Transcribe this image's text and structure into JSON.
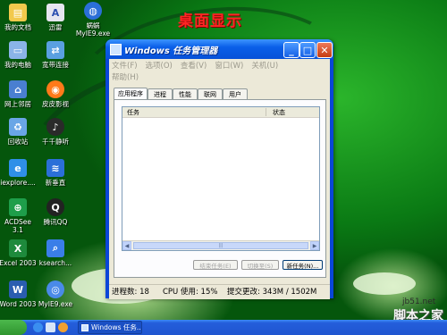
{
  "desktop": {
    "title": "桌面显示",
    "icons": [
      {
        "label": "我的文档",
        "icon": "folder-icon",
        "color": "#f2c94c"
      },
      {
        "label": "迅雷",
        "icon": "thunder-icon",
        "color": "#e6e6f0"
      },
      {
        "label": "蜗蜗",
        "icon": "app-icon",
        "color": "#2b6fd8"
      },
      {
        "label": "MyIE9.exe",
        "icon": "",
        "color": ""
      },
      {
        "label": "我的电脑",
        "icon": "computer-icon",
        "color": "#8ab4e8"
      },
      {
        "label": "宽带连接",
        "icon": "network-icon",
        "color": "#5aa0e0"
      },
      {
        "label": "网上邻居",
        "icon": "network-places-icon",
        "color": "#4a7fd0"
      },
      {
        "label": "皮皮影视",
        "icon": "video-icon",
        "color": "#ff7a1a"
      },
      {
        "label": "回收站",
        "icon": "recycle-bin-icon",
        "color": "#6aa6e6"
      },
      {
        "label": "千千静听",
        "icon": "music-icon",
        "color": "#2a2a2a"
      },
      {
        "label": "iexplore....",
        "icon": "ie-icon",
        "color": "#2f8fe8"
      },
      {
        "label": "新垂直",
        "icon": "app-icon",
        "color": "#2b6fd8"
      },
      {
        "label": "ACDSee",
        "icon": "acdsee-icon",
        "color": "#1e9e4a"
      },
      {
        "label": "3.1",
        "icon": "",
        "color": ""
      },
      {
        "label": "腾讯QQ",
        "icon": "qq-icon",
        "color": "#222222"
      },
      {
        "label": "Excel 2003",
        "icon": "excel-icon",
        "color": "#1e8a3c"
      },
      {
        "label": "ksearch...",
        "icon": "search-icon",
        "color": "#3a7ee8"
      },
      {
        "label": "Word 2003",
        "icon": "word-icon",
        "color": "#2a5db0"
      },
      {
        "label": "MyIE9.exe",
        "icon": "myie-icon",
        "color": "#4a8ae8"
      }
    ]
  },
  "window": {
    "title": "Windows 任务管理器",
    "menu": [
      "文件(F)",
      "选项(O)",
      "查看(V)",
      "窗口(W)",
      "关机(U)",
      "帮助(H)"
    ],
    "tabs": [
      "应用程序",
      "进程",
      "性能",
      "联网",
      "用户"
    ],
    "columns": [
      "任务",
      "状态"
    ],
    "buttons": {
      "end_task": "结束任务(E)",
      "switch_to": "切换至(S)",
      "new_task": "新任务(N)..."
    },
    "status": {
      "processes": "进程数: 18",
      "cpu": "CPU 使用: 15%",
      "commit": "提交更改: 343M / 1502M"
    }
  },
  "taskbar": {
    "task_label": "Windows 任务...",
    "colors": {
      "bar": "#245edb",
      "start": "#2f952f"
    }
  },
  "watermark": {
    "line1": "jb51.net",
    "line2": "脚本之家"
  }
}
